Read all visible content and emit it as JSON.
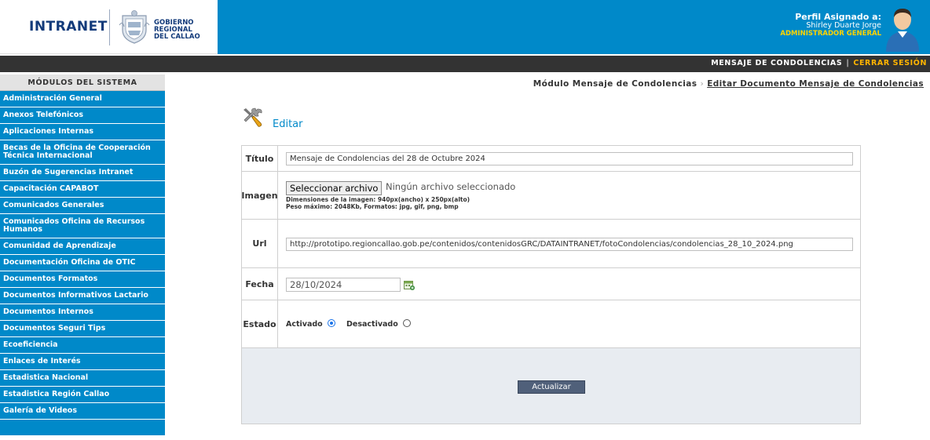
{
  "header": {
    "brand": "INTRANET",
    "gov_line1": "GOBIERNO",
    "gov_line2": "REGIONAL",
    "gov_line3": "DEL CALLAO",
    "profile_title": "Perfil Asignado a:",
    "profile_name": "Shirley Duarte Jorge",
    "profile_role": "ADMINISTRADOR GENERAL"
  },
  "topnav": {
    "module": "MENSAJE DE CONDOLENCIAS",
    "separator": "|",
    "logout": "CERRAR SESIÓN"
  },
  "sidebar": {
    "title": "MÓDULOS DEL SISTEMA",
    "items": [
      {
        "label": "Administración General"
      },
      {
        "label": "Anexos Telefónicos"
      },
      {
        "label": "Aplicaciones Internas"
      },
      {
        "label": "Becas de la Oficina de Cooperación Técnica Internacional"
      },
      {
        "label": "Buzón de Sugerencias Intranet"
      },
      {
        "label": "Capacitación CAPABOT"
      },
      {
        "label": "Comunicados Generales"
      },
      {
        "label": "Comunicados Oficina de Recursos Humanos"
      },
      {
        "label": "Comunidad de Aprendizaje"
      },
      {
        "label": "Documentación Oficina de OTIC"
      },
      {
        "label": "Documentos Formatos"
      },
      {
        "label": "Documentos Informativos Lactario"
      },
      {
        "label": "Documentos Internos"
      },
      {
        "label": "Documentos Seguri Tips"
      },
      {
        "label": "Ecoeficiencia"
      },
      {
        "label": "Enlaces de Interés"
      },
      {
        "label": "Estadistica Nacional"
      },
      {
        "label": "Estadistica Región Callao"
      },
      {
        "label": "Galería de Videos"
      }
    ]
  },
  "breadcrumb": {
    "parent": "Módulo Mensaje de Condolencias",
    "arrow": "›",
    "current": "Editar Documento Mensaje de Condolencias"
  },
  "page": {
    "title": "Editar"
  },
  "form": {
    "titulo_label": "Título",
    "titulo_value": "Mensaje de Condolencias del 28 de Octubre 2024",
    "imagen_label": "Imagen",
    "file_button": "Seleccionar archivo",
    "file_status": "Ningún archivo seleccionado",
    "hint_dimensions": "Dimensiones de la imagen: 940px(ancho) x 250px(alto)",
    "hint_weight": "Peso máximo: 2048Kb, Formatos: jpg, gif, png, bmp",
    "url_label": "Url",
    "url_value": "http://prototipo.regioncallao.gob.pe/contenidos/contenidosGRC/DATAINTRANET/fotoCondolencias/condolencias_28_10_2024.png",
    "fecha_label": "Fecha",
    "fecha_value": "28/10/2024",
    "estado_label": "Estado",
    "activado_label": "Activado",
    "desactivado_label": "Desactivado",
    "estado_selected": "Activado",
    "submit_label": "Actualizar"
  },
  "colors": {
    "primary_blue": "#0089c9",
    "dark_bar": "#333333",
    "logout_accent": "#ffb400",
    "role_accent": "#ffd400",
    "button_bg": "#50607a"
  }
}
